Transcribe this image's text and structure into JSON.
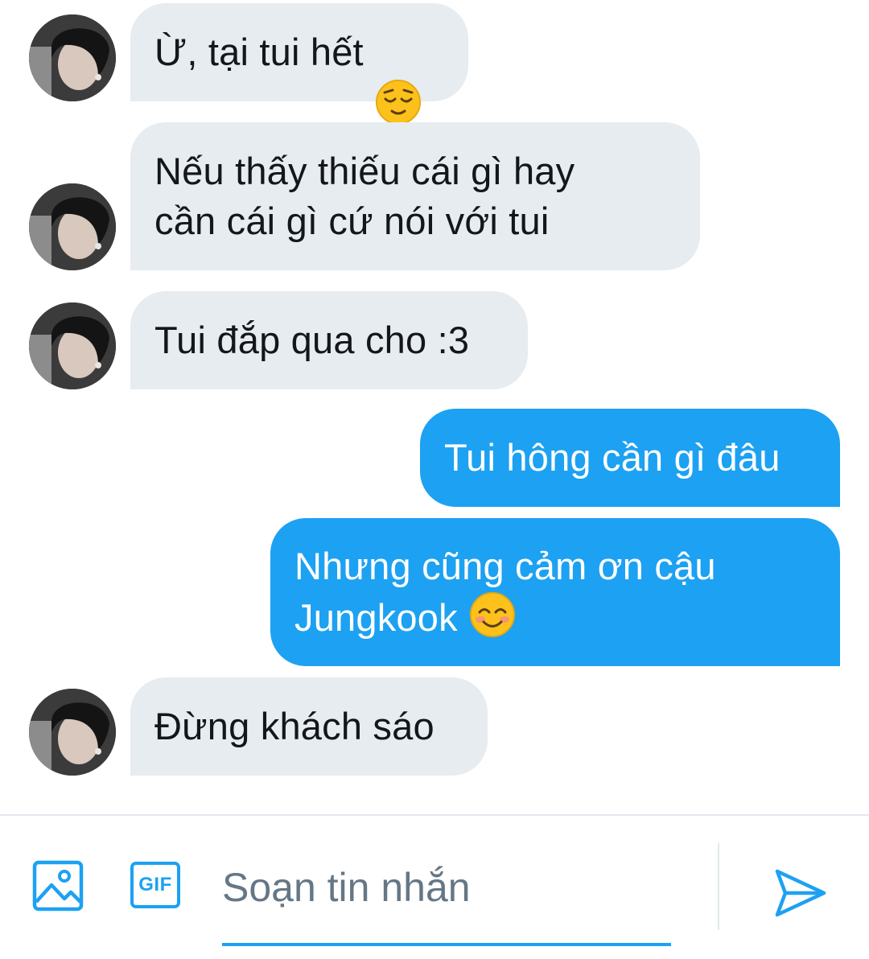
{
  "messages": [
    {
      "sender": "other",
      "text": "Ừ, tại tui hết",
      "emoji": "relieved-face"
    },
    {
      "sender": "other",
      "text": "Nếu thấy thiếu cái gì hay\ncần cái gì cứ nói với tui"
    },
    {
      "sender": "other",
      "text": "Tui đắp qua cho :3"
    },
    {
      "sender": "me",
      "text": "Tui hông cần gì đâu"
    },
    {
      "sender": "me",
      "text": "Nhưng cũng cảm ơn cậu\nJungkook",
      "emoji": "smiling-face-with-smiling-eyes"
    },
    {
      "sender": "other",
      "text": "Đừng khách sáo"
    }
  ],
  "composer": {
    "placeholder": "Soạn tin nhắn",
    "value": "",
    "gif_label": "GIF",
    "icons": [
      "image-icon",
      "gif-icon",
      "send-icon"
    ]
  },
  "colors": {
    "incoming_bubble": "#e6ecf0",
    "outgoing_bubble": "#1da1f2",
    "accent": "#1da1f2",
    "text": "#14171a",
    "placeholder": "#657786"
  }
}
